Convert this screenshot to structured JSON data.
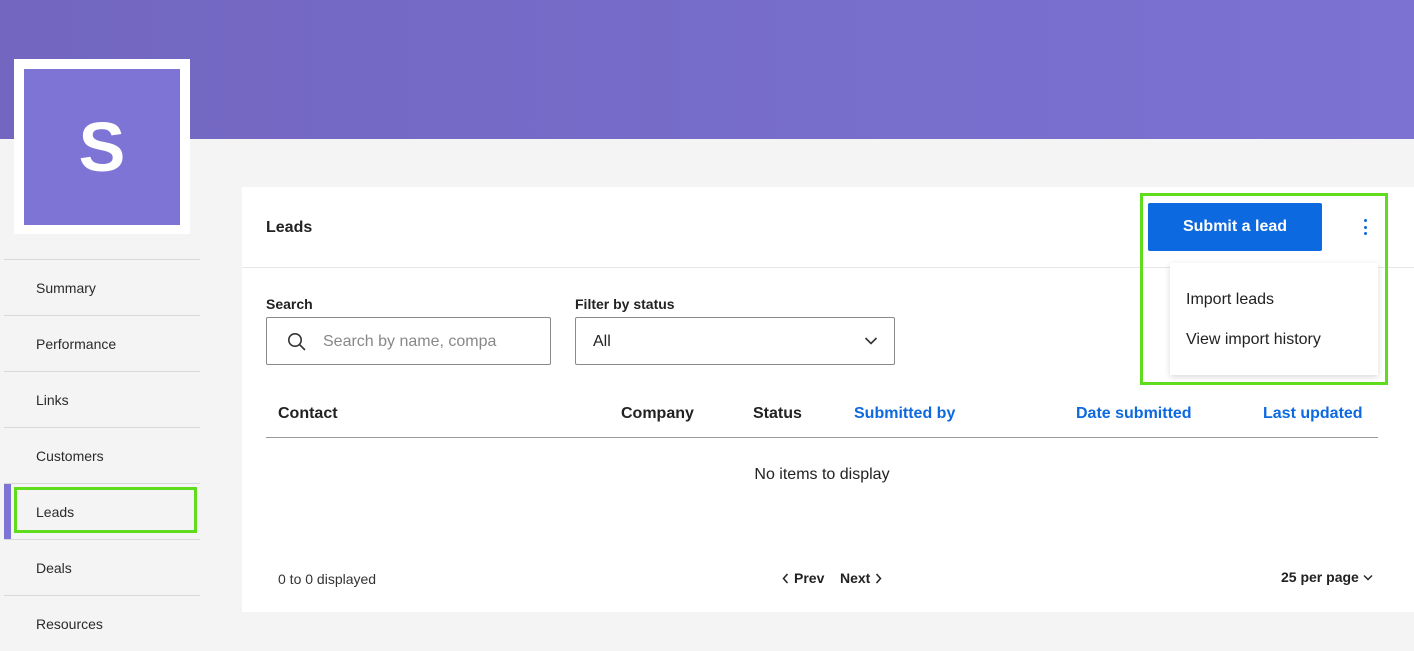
{
  "brand": {
    "logo_letter": "S",
    "banner_color": "#7b72d2",
    "logo_color": "#7d74d6"
  },
  "sidebar": {
    "items": [
      {
        "label": "Summary"
      },
      {
        "label": "Performance"
      },
      {
        "label": "Links"
      },
      {
        "label": "Customers"
      },
      {
        "label": "Leads",
        "active": true
      },
      {
        "label": "Deals"
      },
      {
        "label": "Resources"
      }
    ]
  },
  "card": {
    "title": "Leads",
    "submit_label": "Submit a lead",
    "more_icon": "kebab-vertical-icon",
    "menu": {
      "items": [
        "Import leads",
        "View import history"
      ]
    },
    "search": {
      "label": "Search",
      "placeholder": "Search by name, compa",
      "icon": "search-icon"
    },
    "filter": {
      "label": "Filter by status",
      "value": "All",
      "icon": "chevron-down-icon"
    },
    "table": {
      "columns": [
        {
          "label": "Contact",
          "sortable": false
        },
        {
          "label": "Company",
          "sortable": false
        },
        {
          "label": "Status",
          "sortable": false
        },
        {
          "label": "Submitted by",
          "sortable": true
        },
        {
          "label": "Date submitted",
          "sortable": true
        },
        {
          "label": "Last updated",
          "sortable": true
        }
      ],
      "empty_text": "No items to display"
    },
    "footer": {
      "count_text": "0 to 0 displayed",
      "prev_label": "Prev",
      "next_label": "Next",
      "per_page_label": "25 per page"
    }
  },
  "colors": {
    "accent": "#0d69e0",
    "highlight": "#5fdd1c",
    "active_nav": "#7d74d6"
  }
}
